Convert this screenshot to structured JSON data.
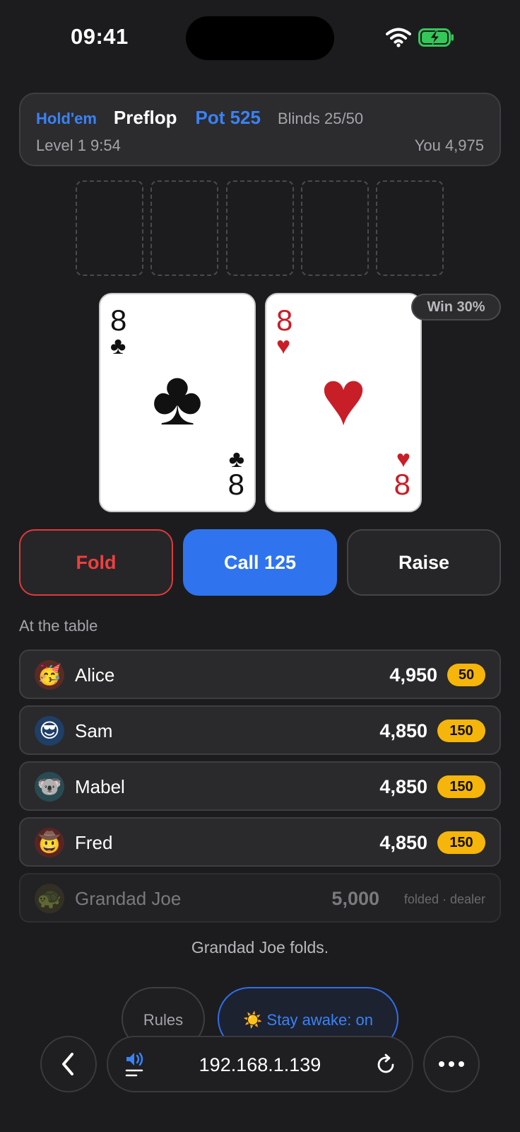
{
  "status_bar": {
    "time": "09:41"
  },
  "header": {
    "game_type": "Hold'em",
    "street": "Preflop",
    "pot": "Pot 525",
    "blinds": "Blinds 25/50",
    "level": "Level 1 9:54",
    "you": "You 4,975"
  },
  "hole_cards": [
    {
      "rank": "8",
      "suit": "♣",
      "suit_name": "clubs",
      "color": "#111111"
    },
    {
      "rank": "8",
      "suit": "♥",
      "suit_name": "hearts",
      "color": "#c81e28"
    }
  ],
  "win_badge": "Win 30%",
  "actions": {
    "fold": "Fold",
    "call": "Call 125",
    "raise": "Raise"
  },
  "section_label": "At the table",
  "players": [
    {
      "name": "Alice",
      "avatar": "🥳",
      "chips": "4,950",
      "bet": "50"
    },
    {
      "name": "Sam",
      "avatar": "😎",
      "chips": "4,850",
      "bet": "150"
    },
    {
      "name": "Mabel",
      "avatar": "🐨",
      "chips": "4,850",
      "bet": "150"
    },
    {
      "name": "Fred",
      "avatar": "🤠",
      "chips": "4,850",
      "bet": "150"
    },
    {
      "name": "Grandad Joe",
      "avatar": "🐢",
      "chips": "5,000",
      "status": "folded · dealer"
    }
  ],
  "log_message": "Grandad Joe folds.",
  "bottom_buttons": {
    "rules": "Rules",
    "stay_awake": "☀️ Stay awake: on"
  },
  "browser": {
    "url": "192.168.1.139"
  },
  "colors": {
    "accent": "#3a82f7",
    "fold": "#ef3f3f",
    "bet_chip": "#f5b50a"
  }
}
